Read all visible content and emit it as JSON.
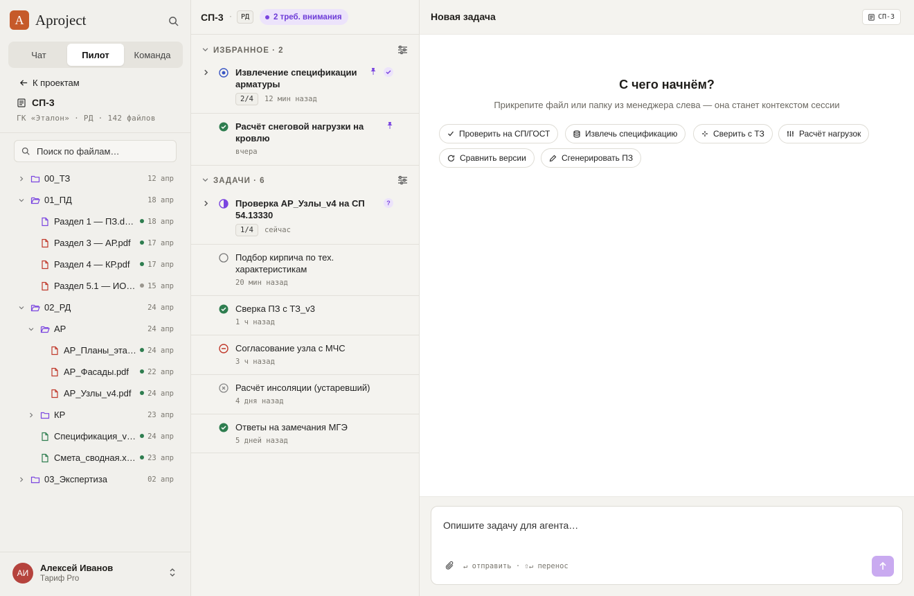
{
  "brand": {
    "name": "Aproject",
    "logo_letter": "A"
  },
  "segments": [
    "Чат",
    "Пилот",
    "Команда"
  ],
  "back_label": "К проектам",
  "project": {
    "name": "СП-3",
    "meta": "ГК «Эталон» · РД · 142 файлов"
  },
  "file_search_placeholder": "Поиск по файлам…",
  "tree": [
    {
      "name": "00_ТЗ",
      "date": "12 апр"
    },
    {
      "name": "01_ПД",
      "date": "18 апр"
    },
    {
      "name": "Раздел 1 — ПЗ.docx",
      "date": "18 апр"
    },
    {
      "name": "Раздел 3 — АР.pdf",
      "date": "17 апр"
    },
    {
      "name": "Раздел 4 — КР.pdf",
      "date": "17 апр"
    },
    {
      "name": "Раздел 5.1 — ИОС…",
      "date": "15 апр"
    },
    {
      "name": "02_РД",
      "date": "24 апр"
    },
    {
      "name": "АР",
      "date": "24 апр"
    },
    {
      "name": "АР_Планы_эта…",
      "date": "24 апр"
    },
    {
      "name": "АР_Фасады.pdf",
      "date": "22 апр"
    },
    {
      "name": "АР_Узлы_v4.pdf",
      "date": "24 апр"
    },
    {
      "name": "КР",
      "date": "23 апр"
    },
    {
      "name": "Спецификация_v…",
      "date": "24 апр"
    },
    {
      "name": "Смета_сводная.xl…",
      "date": "23 апр"
    },
    {
      "name": "03_Экспертиза",
      "date": "02 апр"
    }
  ],
  "user": {
    "initials": "АИ",
    "name": "Алексей Иванов",
    "plan": "Тариф Pro"
  },
  "middle": {
    "title": "СП-3",
    "sep": "·",
    "tag": "РД",
    "badge": "2 треб. внимания",
    "favorites_label": "ИЗБРАННОЕ · 2",
    "tasks_label": "ЗАДАЧИ · 6",
    "favorites": [
      {
        "title": "Извлечение спецификации арматуры",
        "progress": "2/4",
        "time": "12 мин назад"
      },
      {
        "title": "Расчёт снеговой нагрузки на кровлю",
        "time": "вчера"
      }
    ],
    "tasks": [
      {
        "title": "Проверка АР_Узлы_v4 на СП 54.13330",
        "progress": "1/4",
        "time": "сейчас",
        "flag": "?"
      },
      {
        "title": "Подбор кирпича по тех. характеристикам",
        "time": "20 мин назад"
      },
      {
        "title": "Сверка ПЗ с ТЗ_v3",
        "time": "1 ч назад"
      },
      {
        "title": "Согласование узла с МЧС",
        "time": "3 ч назад"
      },
      {
        "title": "Расчёт инсоляции (устаревший)",
        "time": "4 дня назад"
      },
      {
        "title": "Ответы на замечания МГЭ",
        "time": "5 дней назад"
      }
    ]
  },
  "right": {
    "title": "Новая задача",
    "tag": "СП-3",
    "hero": "С чего начнём?",
    "hero_sub": "Прикрепите файл или папку из менеджера слева — она станет контекстом сессии",
    "actions": [
      "Проверить на СП/ГОСТ",
      "Извлечь спецификацию",
      "Сверить с ТЗ",
      "Расчёт нагрузок",
      "Сравнить версии",
      "Сгенерировать ПЗ"
    ],
    "composer_placeholder": "Опишите задачу для агента…",
    "composer_hint": "↵ отправить · ⇧↵ перенос"
  },
  "colors": {
    "accent": "#7a45e0",
    "brand": "#c65a2a",
    "done": "#2e7d4f",
    "blocked": "#c0392b"
  }
}
